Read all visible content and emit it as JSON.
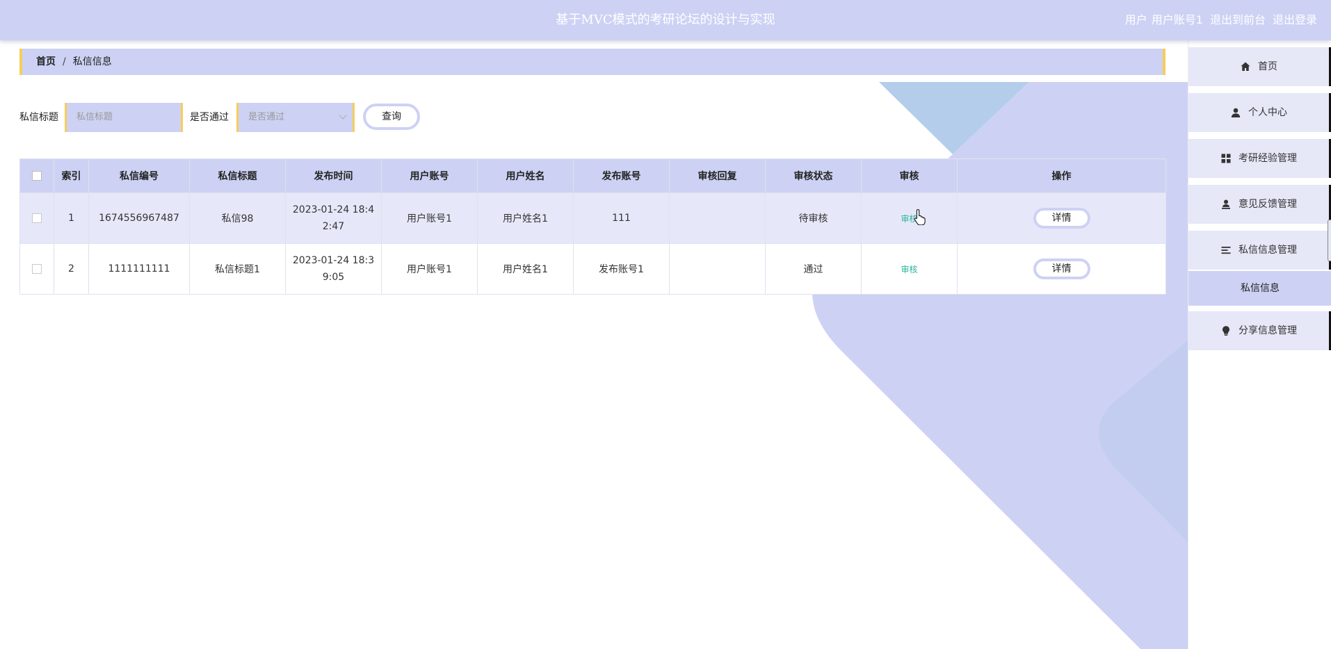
{
  "header": {
    "title": "基于MVC模式的考研论坛的设计与实现",
    "role_label": "用户",
    "username": "用户账号1",
    "front_link": "退出到前台",
    "logout_link": "退出登录"
  },
  "breadcrumb": {
    "home": "首页",
    "separator": "/",
    "current": "私信信息"
  },
  "search": {
    "title_label": "私信标题",
    "title_placeholder": "私信标题",
    "pass_label": "是否通过",
    "pass_placeholder": "是否通过",
    "query_button": "查询"
  },
  "table": {
    "columns": [
      "索引",
      "私信编号",
      "私信标题",
      "发布时间",
      "用户账号",
      "用户姓名",
      "发布账号",
      "审核回复",
      "审核状态",
      "审核",
      "操作"
    ],
    "rows": [
      {
        "index": "1",
        "code": "1674556967487",
        "title": "私信98",
        "time_line1": "2023-01-24 18:4",
        "time_line2": "2:47",
        "user_account": "用户账号1",
        "user_name": "用户姓名1",
        "publisher": "111",
        "reply": "",
        "status": "待审核",
        "audit": "审核",
        "action": "详情"
      },
      {
        "index": "2",
        "code": "1111111111",
        "title": "私信标题1",
        "time_line1": "2023-01-24 18:3",
        "time_line2": "9:05",
        "user_account": "用户账号1",
        "user_name": "用户姓名1",
        "publisher": "发布账号1",
        "reply": "",
        "status": "通过",
        "audit": "审核",
        "action": "详情"
      }
    ]
  },
  "sidebar": {
    "items": [
      {
        "label": "首页",
        "icon": "home-icon"
      },
      {
        "label": "个人中心",
        "icon": "user-icon"
      },
      {
        "label": "考研经验管理",
        "icon": "grid-icon"
      },
      {
        "label": "意见反馈管理",
        "icon": "user-stamp-icon"
      },
      {
        "label": "私信信息管理",
        "icon": "list-icon"
      },
      {
        "label": "私信信息",
        "icon": ""
      },
      {
        "label": "分享信息管理",
        "icon": "bulb-icon"
      }
    ]
  },
  "colors": {
    "accent": "#cdd2f4",
    "border_accent": "#f7cd5a",
    "audit_green": "#2bb39a",
    "row_highlight": "#e6e8fa"
  }
}
